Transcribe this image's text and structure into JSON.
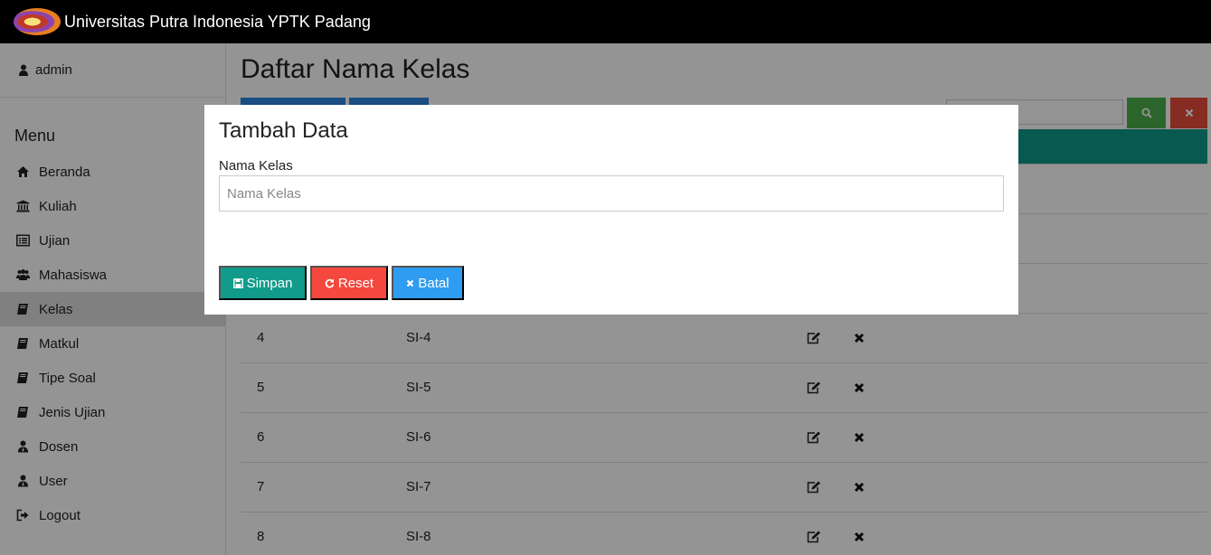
{
  "app": {
    "title": "Universitas Putra Indonesia YPTK Padang"
  },
  "user": {
    "name": "admin"
  },
  "sidebar": {
    "menu_title": "Menu",
    "items": [
      {
        "label": "Beranda",
        "icon": "home-icon"
      },
      {
        "label": "Kuliah",
        "icon": "institution-icon"
      },
      {
        "label": "Ujian",
        "icon": "list-icon"
      },
      {
        "label": "Mahasiswa",
        "icon": "users-icon"
      },
      {
        "label": "Kelas",
        "icon": "book-icon",
        "active": true
      },
      {
        "label": "Matkul",
        "icon": "book-icon"
      },
      {
        "label": "Tipe Soal",
        "icon": "book-icon"
      },
      {
        "label": "Jenis Ujian",
        "icon": "book-icon"
      },
      {
        "label": "Dosen",
        "icon": "user-tie-icon"
      },
      {
        "label": "User",
        "icon": "user-tie-icon"
      },
      {
        "label": "Logout",
        "icon": "sign-out-icon"
      }
    ]
  },
  "main": {
    "title": "Daftar Nama Kelas",
    "rows": [
      {
        "no": "4",
        "kelas": "SI-4"
      },
      {
        "no": "5",
        "kelas": "SI-5"
      },
      {
        "no": "6",
        "kelas": "SI-6"
      },
      {
        "no": "7",
        "kelas": "SI-7"
      },
      {
        "no": "8",
        "kelas": "SI-8"
      }
    ]
  },
  "modal": {
    "title": "Tambah Data",
    "field_label": "Nama Kelas",
    "field_placeholder": "Nama Kelas",
    "field_value": "",
    "buttons": {
      "save": "Simpan",
      "reset": "Reset",
      "cancel": "Batal"
    }
  },
  "colors": {
    "primary": "#2e86de",
    "teal": "#0e9988",
    "danger": "#e74c3c",
    "success": "#4cae4c",
    "topbar": "#000000"
  }
}
